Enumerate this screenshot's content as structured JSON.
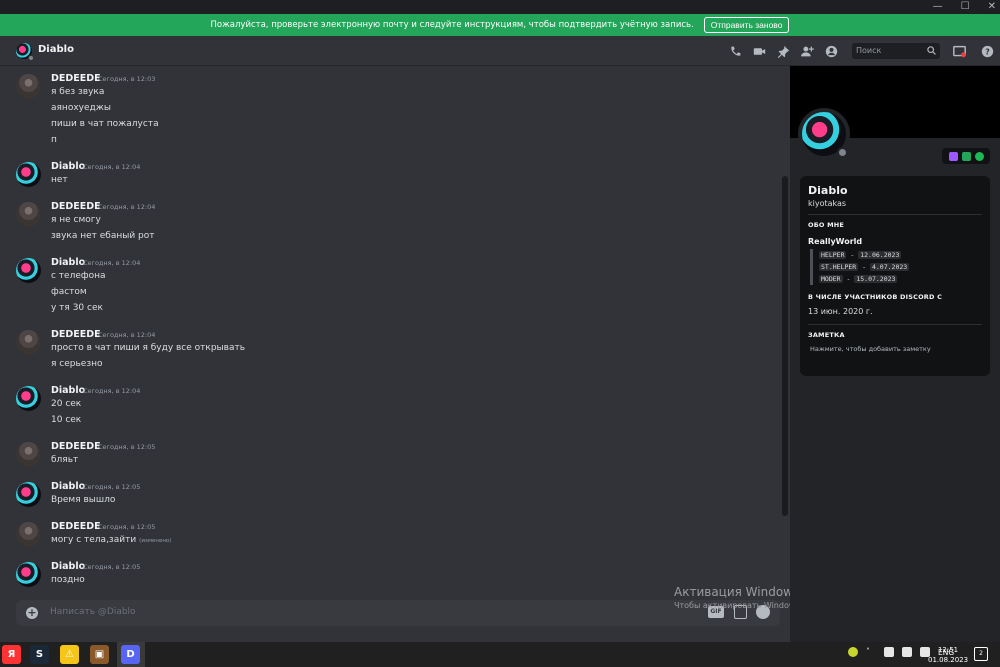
{
  "window": {
    "minimize": "—",
    "maximize": "☐",
    "close": "✕"
  },
  "banner": {
    "text": "Пожалуйста, проверьте электронную почту и следуйте инструкциям, чтобы подтвердить учётную запись.",
    "button": "Отправить заново",
    "color": "#23a55a"
  },
  "header": {
    "dm_name": "Diablo",
    "search_placeholder": "Поиск",
    "icons": [
      "call-icon",
      "video-icon",
      "pin-icon",
      "add-friend-icon",
      "profile-icon",
      "inbox-icon",
      "help-icon"
    ]
  },
  "messages": [
    {
      "author": "DEDEEDE",
      "time": "Сегодня, в 12:03",
      "avatar": "dede",
      "lines": [
        "я без звука",
        "аянохуеджы",
        "пиши в чат пожалуста",
        "п"
      ]
    },
    {
      "author": "Diablo",
      "time": "Сегодня, в 12:04",
      "avatar": "diablo",
      "lines": [
        "нет"
      ]
    },
    {
      "author": "DEDEEDE",
      "time": "Сегодня, в 12:04",
      "avatar": "dede",
      "lines": [
        "я не смогу",
        "звука нет ебаный рот"
      ]
    },
    {
      "author": "Diablo",
      "time": "Сегодня, в 12:04",
      "avatar": "diablo",
      "lines": [
        "с телефона",
        "фастом",
        "у тя 30 сек"
      ]
    },
    {
      "author": "DEDEEDE",
      "time": "Сегодня, в 12:04",
      "avatar": "dede",
      "lines": [
        "просто в чат пиши я  буду все открывать",
        "я серьезно"
      ]
    },
    {
      "author": "Diablo",
      "time": "Сегодня, в 12:04",
      "avatar": "diablo",
      "lines": [
        "20 сек",
        "10 сек"
      ]
    },
    {
      "author": "DEDEEDE",
      "time": "Сегодня, в 12:05",
      "avatar": "dede",
      "lines": [
        "бляьт"
      ]
    },
    {
      "author": "Diablo",
      "time": "Сегодня, в 12:05",
      "avatar": "diablo",
      "lines": [
        "Время вышло"
      ]
    },
    {
      "author": "DEDEEDE",
      "time": "Сегодня, в 12:05",
      "avatar": "dede",
      "lines": [
        "могу с тела,зайти"
      ],
      "edited": "(изменено)"
    },
    {
      "author": "Diablo",
      "time": "Сегодня, в 12:05",
      "avatar": "diablo",
      "lines": [
        "поздно"
      ]
    }
  ],
  "input": {
    "placeholder": "Написать @Diablo",
    "gif": "GIF"
  },
  "watermark": {
    "title": "Активация Windows",
    "subtitle": "Чтобы активировать Windows, перейдите в раздел \"Параметры\"."
  },
  "profile": {
    "name": "Diablo",
    "tag": "kiyotakas",
    "about_heading": "ОБО МНЕ",
    "about_title": "ReallyWorld",
    "roles": [
      {
        "role": "HELPER",
        "date": "12.06.2023"
      },
      {
        "role": "ST.HELPER",
        "date": "4.07.2023"
      },
      {
        "role": "MODER",
        "date": "15.07.2023"
      }
    ],
    "member_heading": "В ЧИСЛЕ УЧАСТНИКОВ DISCORD С",
    "member_date": "13 июн. 2020 г.",
    "note_heading": "ЗАМЕТКА",
    "note_placeholder": "Нажмите, чтобы добавить заметку"
  },
  "taskbar": {
    "apps": [
      {
        "name": "yandex-browser",
        "glyph": "Я",
        "color": "#f33"
      },
      {
        "name": "steam",
        "glyph": "S",
        "color": "#1b2838"
      },
      {
        "name": "app-yellow",
        "glyph": "⚠",
        "color": "#f5c518"
      },
      {
        "name": "minecraft",
        "glyph": "▣",
        "color": "#8b5a2b"
      },
      {
        "name": "discord",
        "glyph": "D",
        "color": "#5865f2"
      }
    ],
    "lang": "ENG",
    "time": "12:51",
    "date": "01.08.2023",
    "notifications": "2"
  }
}
